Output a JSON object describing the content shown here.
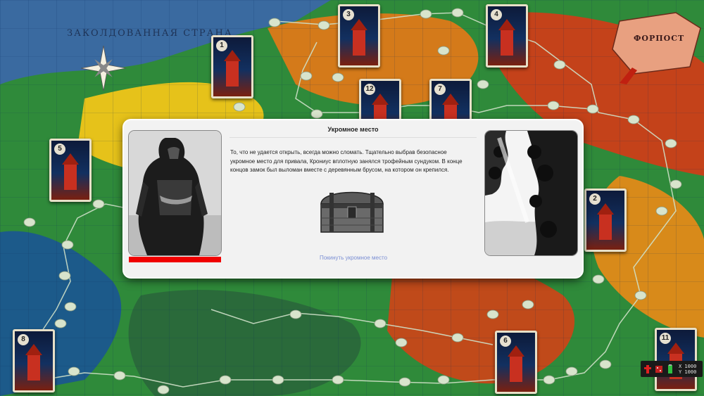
{
  "map": {
    "region_label": "ЗАКОЛДОВАННАЯ СТРАНА",
    "fort_label": "ФОРПОСТ",
    "castle_cards": [
      {
        "num": "1"
      },
      {
        "num": "3"
      },
      {
        "num": "4"
      },
      {
        "num": "12"
      },
      {
        "num": "7"
      },
      {
        "num": "5"
      },
      {
        "num": "2"
      },
      {
        "num": "8"
      },
      {
        "num": "6"
      },
      {
        "num": "11"
      }
    ]
  },
  "dialog": {
    "title": "Укромное место",
    "text": "То, что не удается открыть, всегда можно сломать. Тщательно выбрав безопасное укромное место для привала, Крониус вплотную занялся трофейным сундуком. В конце концов замок был выломан вместе с деревянным брусом, на котором он крепился.",
    "leave_link": "Покинуть укромное место",
    "hero_health": 1.0
  },
  "hud": {
    "x_label": "X 1000",
    "y_label": "Y 1000"
  },
  "colors": {
    "health_bar": "#f00000",
    "link": "#7b8fd4",
    "dialog_bg": "#f2f2f2"
  }
}
